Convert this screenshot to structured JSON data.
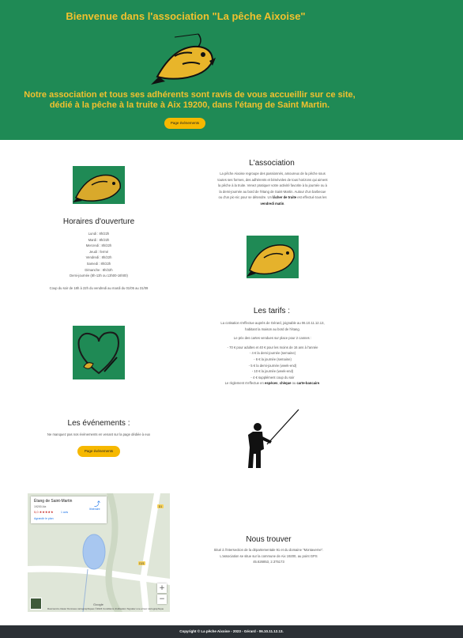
{
  "hero": {
    "title": "Bienvenue dans l'association \"La pêche Aixoise\"",
    "intro_line1": "Notre association et tous ses adhérents sont ravis de vous accueillir sur ce site,",
    "intro_line2": "dédié à la pêche à la truite à Aix 19200, dans l'étang de Saint Martin.",
    "button": "Page événements"
  },
  "association": {
    "title": "L'association",
    "lines": [
      "La pêche Aixoise regroupe des passionnés, amoureux de la pêche sous",
      "toutes ses formes, des adhérents et bénévoles de tous horizons qui aiment",
      "la pêche à la truite. Venez pratiquer votre activité favorite à la journée ou à",
      "la demi-journée au bord de l'étang de Saint-Martin. Autour d'un barbecue",
      "ou d'un pic-nic pour se détendre. Un"
    ],
    "highlight": "lâcher de truite",
    "after_highlight": " est effectué tous les",
    "last_bold": "vendredi matin",
    "last_end": "."
  },
  "horaires": {
    "title": "Horaires d'ouverture",
    "rows": [
      "Lundi : 8h/22h",
      "Mardi : 8h/22h",
      "Mercredi : 8h/22h",
      "Jeudi : fermé",
      "Vendredi : 8h/22h",
      "Samedi : 8h/22h",
      "Dimanche : 8h/22h",
      "Demi-journée (8h-13h ou 13h00-16h00)"
    ],
    "note": "Coup du soir de 18h à 22h du vendredi au mardi du 01/05 au 31/09"
  },
  "tarifs": {
    "title": "Les tarifs :",
    "intro1": "La cotisation s'effectue auprès de Gérard, joignable au 06.10.11.12.13,",
    "intro2": "habitant la maison au bord de l'étang.",
    "intro3": "Le prix des cartes vendues sur place pour 2 cannes :",
    "items": [
      "- 70 € pour adultes et 40 € pour les moins de 16 ans à l'année",
      "- 4 € la demi-journée (semaine)",
      "- 6 € la journée (semaine)",
      "- 5 € la demi-journée (week-end)",
      "- 10 € la journée (week-end)",
      "- 4 € supplément coup du soir"
    ],
    "payment_prefix": "Le règlement s'effectue en ",
    "pay1": "espèces",
    "pay2": "chèque",
    "pay3": "carte-bancaire",
    "sep1": ", ",
    "sep2": " ou ",
    "end": "."
  },
  "evenements": {
    "title": "Les événements :",
    "text": "Ne manquez pas nos évènements en venant sur la page dédiée à eux",
    "button": "Page événements"
  },
  "map": {
    "place": "Étang de Saint-Martin",
    "code": "19200 Aix",
    "rating": "5,0 ★★★★★",
    "reviews": "1 avis",
    "bigger": "Agrandir le plan",
    "directions": "Itinéraire",
    "zoom_in": "+",
    "zoom_out": "−",
    "google": "Google",
    "footer": "Raccourcis clavier   Données cartographiques ©2024   Conditions d'utilisation   Signaler une erreur cartographique",
    "road_label1": "D1",
    "road_label2": "D21"
  },
  "trouver": {
    "title": "Nous trouver",
    "line1": "Situé à l'intersection de la départementale 91 et du domaine \"Montaverne\".",
    "line2": "L'association se situe sur la commune de Aix 19200, au point GPS",
    "line3": "45.626853, 2.375173"
  },
  "footer": {
    "text": "Copyright © La pêche Aixoise - 2023 - Gérard - 06.10.11.12.13."
  },
  "colors": {
    "brand_green": "#1f8a55",
    "title_yellow": "#f2c12e",
    "button_yellow": "#f6b800",
    "footer_dark": "#2b3035"
  },
  "icons": {
    "hero": "jumping-fish-logo",
    "association": "fish-icon",
    "horaires": "fish-icon",
    "tarifs": "heart-rod-icon",
    "evenements": "fisherman-silhouette"
  }
}
